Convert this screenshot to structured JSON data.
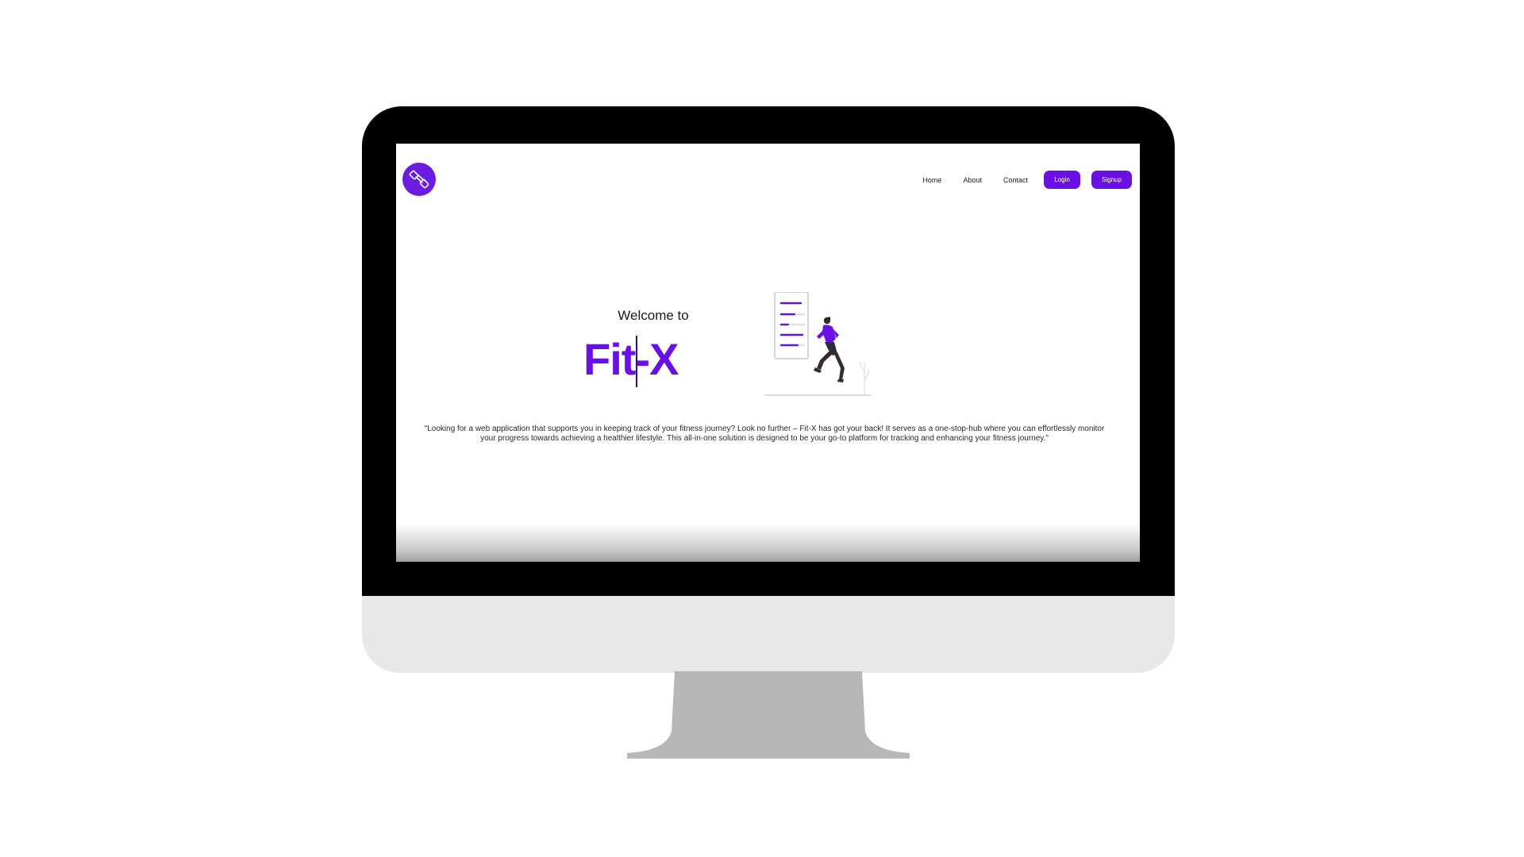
{
  "nav": {
    "logo_icon": "dumbbell-icon",
    "links": [
      "Home",
      "About",
      "Contact"
    ],
    "login_label": "Login",
    "signup_label": "Signup"
  },
  "hero": {
    "welcome": "Welcome to",
    "brand": "Fit-X",
    "illustration_icon": "runner-checklist-illustration"
  },
  "tagline": "\"Looking for a web application that supports you in keeping track of your fitness journey? Look no further – Fit-X has got your back! It serves as a one-stop-hub where you can effortlessly monitor your progress towards achieving a healthier lifestyle. This all-in-one solution is designed to be your go-to platform for tracking and enhancing your fitness journey.\"",
  "colors": {
    "accent": "#6a10e6",
    "bezel": "#000000",
    "chin": "#e8e8e8",
    "stand": "#b7b7b7"
  }
}
